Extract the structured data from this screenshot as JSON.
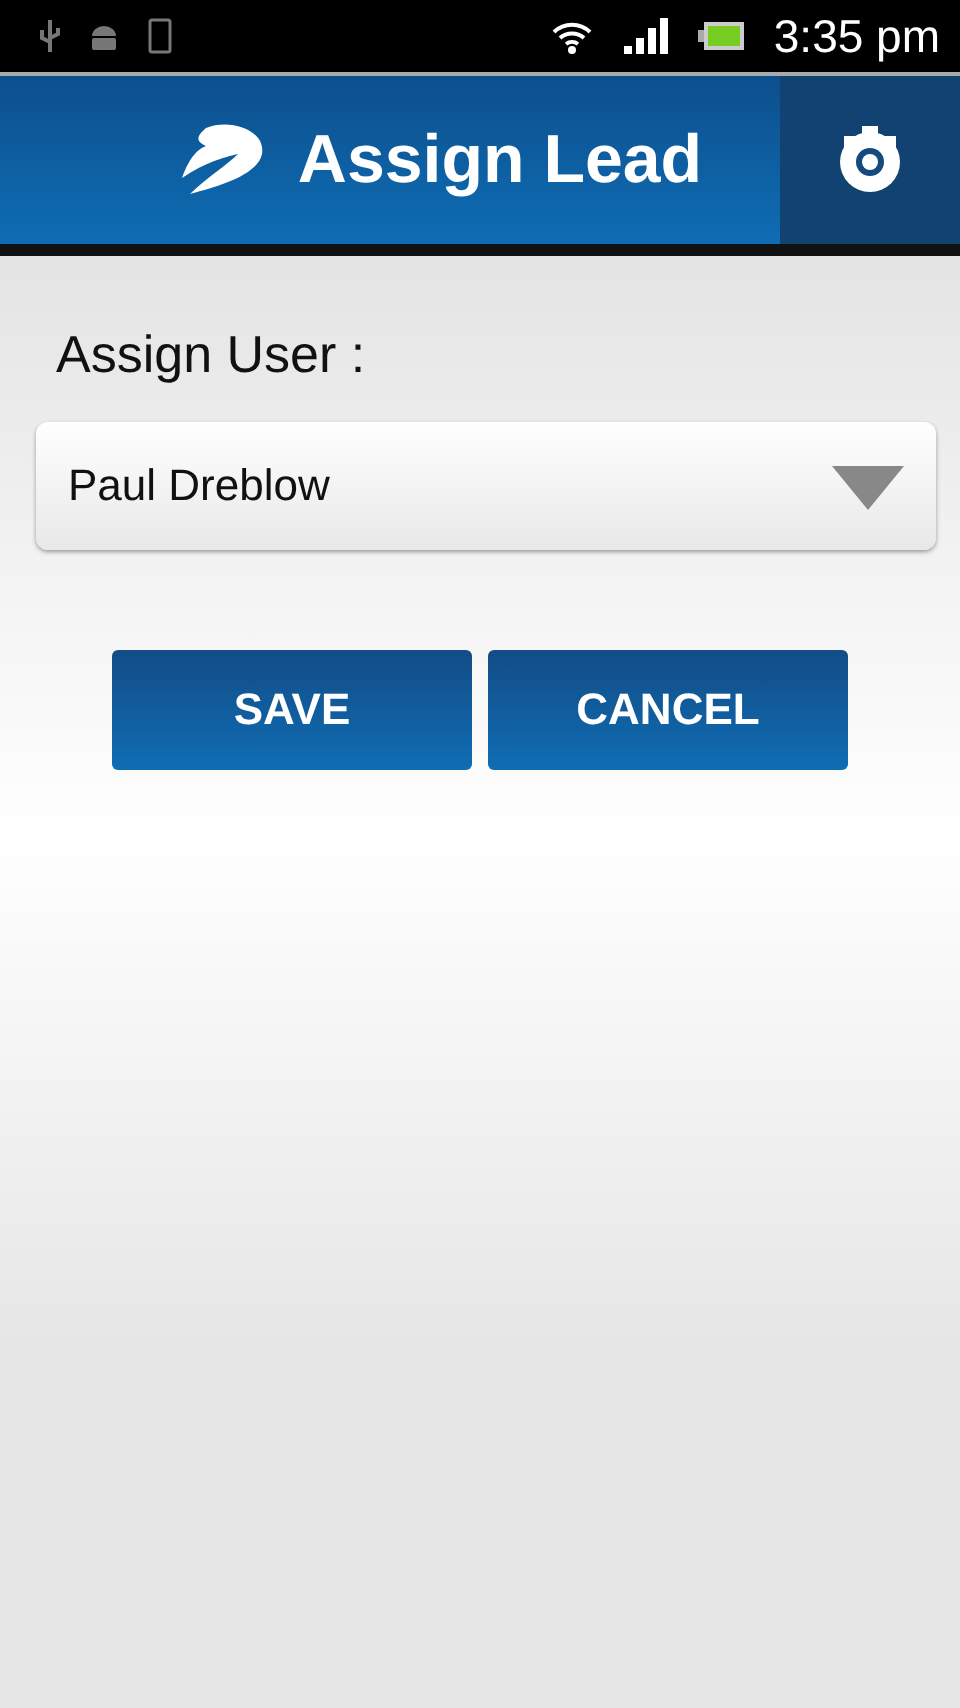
{
  "status_bar": {
    "time": "3:35 pm"
  },
  "header": {
    "title": "Assign Lead"
  },
  "form": {
    "label": "Assign User :",
    "dropdown": {
      "value": "Paul Dreblow"
    }
  },
  "buttons": [
    {
      "label": "SAVE"
    },
    {
      "label": "CANCEL"
    }
  ]
}
